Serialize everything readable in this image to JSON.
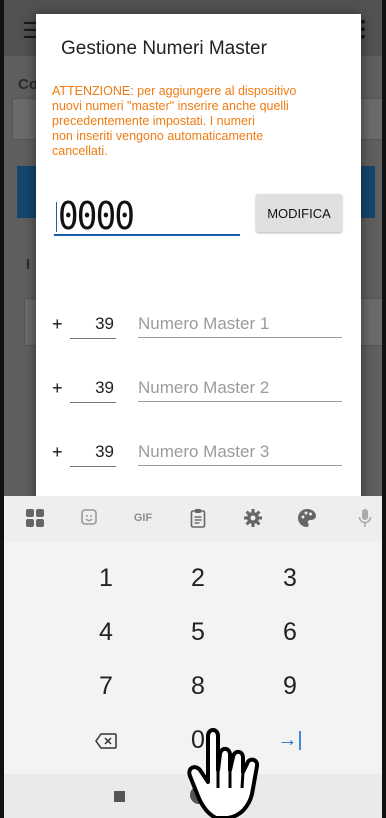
{
  "dialog": {
    "title": "Gestione Numeri Master",
    "warning": "ATTENZIONE: per aggiungere al dispositivo\nnuovi numeri \"master\" inserire anche quelli\nprecedentemente impostati. I numeri\nnon inseriti vengono automaticamente\ncancellati.",
    "pin_value": "0000",
    "modify_button": "MODIFICA",
    "masters": [
      {
        "plus": "+",
        "prefix": "39",
        "placeholder": "Numero Master 1"
      },
      {
        "plus": "+",
        "prefix": "39",
        "placeholder": "Numero Master 2"
      },
      {
        "plus": "+",
        "prefix": "39",
        "placeholder": "Numero Master 3"
      }
    ]
  },
  "background": {
    "letters": [
      "Co",
      "I"
    ]
  },
  "keyboard": {
    "toolbar": [
      {
        "icon": "apps-grid-icon",
        "glyph": "▦"
      },
      {
        "icon": "sticker-icon",
        "glyph": "☺"
      },
      {
        "icon": "gif-icon",
        "glyph": "GIF"
      },
      {
        "icon": "clipboard-icon",
        "glyph": "📋"
      },
      {
        "icon": "settings-icon",
        "glyph": "⚙"
      },
      {
        "icon": "palette-icon",
        "glyph": "🎨"
      },
      {
        "icon": "microphone-icon",
        "glyph": "🎤"
      }
    ],
    "keys": [
      "1",
      "2",
      "3",
      "4",
      "5",
      "6",
      "7",
      "8",
      "9",
      "⌫",
      "0",
      "→|"
    ]
  },
  "colors": {
    "warning": "#f07b12",
    "accent": "#1c5fb0",
    "background_blue": "#14466e"
  }
}
